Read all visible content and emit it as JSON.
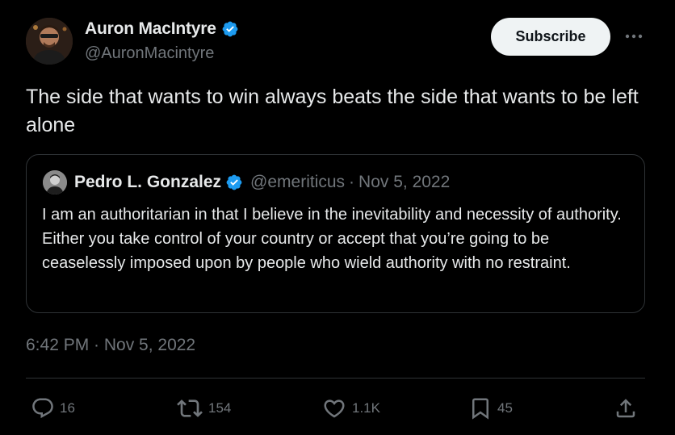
{
  "author": {
    "display_name": "Auron MacIntyre",
    "handle": "@AuronMacintyre",
    "verified": true,
    "avatar_icon": "avatar"
  },
  "header": {
    "subscribe_label": "Subscribe",
    "more_icon": "more-icon"
  },
  "tweet": {
    "text": "The side that wants to win always beats the side that wants to be left alone"
  },
  "quote": {
    "display_name": "Pedro L. Gonzalez",
    "handle": "@emeriticus",
    "separator": "·",
    "date": "Nov 5, 2022",
    "verified": true,
    "text": "I am an authoritarian in that I believe in the inevitability and necessity of authority. Either you take control of your country or accept that you’re going to be ceaselessly imposed upon by people who wield authority with no restraint."
  },
  "timestamp": "6:42 PM · Nov 5, 2022",
  "actions": {
    "replies": "16",
    "retweets": "154",
    "likes": "1.1K",
    "bookmarks": "45",
    "share_icon": "share-icon"
  },
  "colors": {
    "background": "#000000",
    "text": "#e7e9ea",
    "muted": "#71767b",
    "verified": "#1d9bf0",
    "border": "#2f3336",
    "button_bg": "#eff3f4"
  }
}
